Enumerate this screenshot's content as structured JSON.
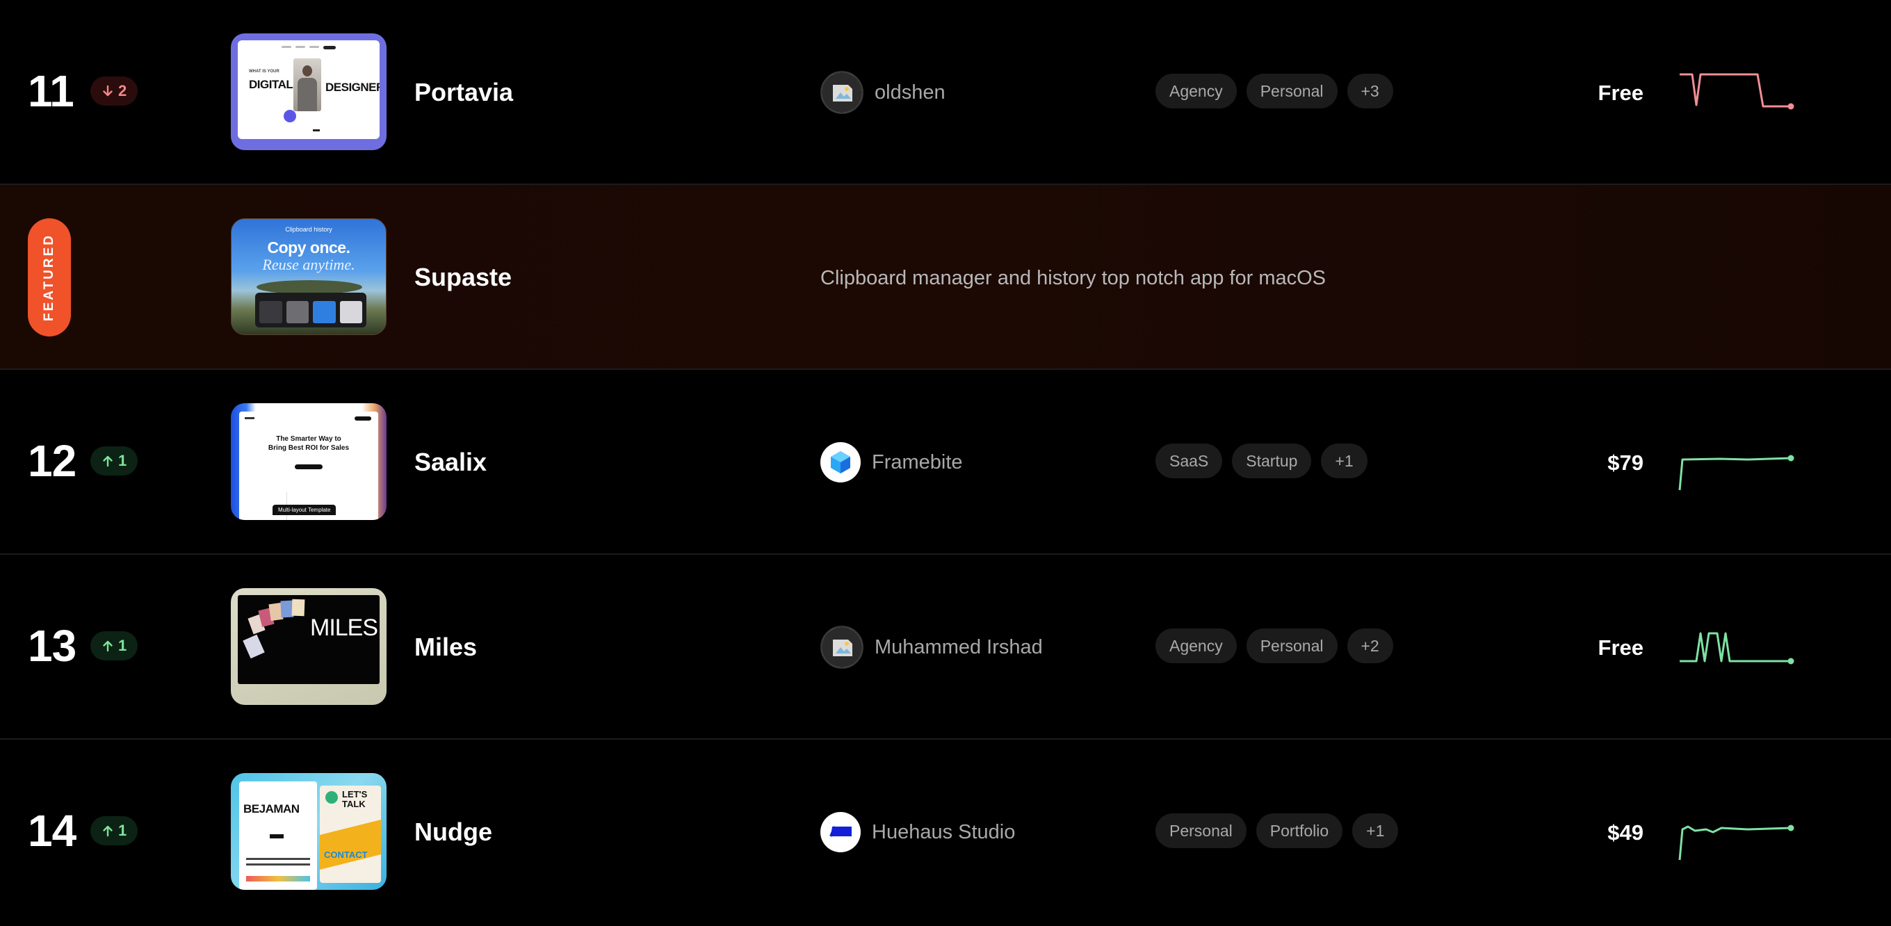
{
  "rows": [
    {
      "rank": "11",
      "delta": {
        "direction": "down",
        "value": "2",
        "icon": "arrow-down-icon"
      },
      "name": "Portavia",
      "author": "oldshen",
      "tags": [
        "Agency",
        "Personal",
        "+3"
      ],
      "price": "Free",
      "thumb_text": {
        "topline": "WHAT IS YOUR",
        "left": "DIGITAL",
        "right": "DESIGNER"
      },
      "trend_color": "#f18f94"
    },
    {
      "featured": true,
      "featured_label": "FEATURED",
      "name": "Supaste",
      "description": "Clipboard manager and history top notch app for macOS",
      "thumb_text": {
        "caption": "Clipboard history",
        "headline": "Copy once.",
        "subline": "Reuse anytime."
      }
    },
    {
      "rank": "12",
      "delta": {
        "direction": "up",
        "value": "1",
        "icon": "arrow-up-icon"
      },
      "name": "Saalix",
      "author": "Framebite",
      "tags": [
        "SaaS",
        "Startup",
        "+1"
      ],
      "price": "$79",
      "thumb_text": {
        "headline": "The Smarter Way to",
        "subline": "Bring Best ROI for Sales",
        "badge": "Multi-layout Template"
      },
      "trend_color": "#7fe1a4"
    },
    {
      "rank": "13",
      "delta": {
        "direction": "up",
        "value": "1",
        "icon": "arrow-up-icon"
      },
      "name": "Miles",
      "author": "Muhammed Irshad",
      "tags": [
        "Agency",
        "Personal",
        "+2"
      ],
      "price": "Free",
      "thumb_text": {
        "headline": "MILES"
      },
      "trend_color": "#7fe1a4"
    },
    {
      "rank": "14",
      "delta": {
        "direction": "up",
        "value": "1",
        "icon": "arrow-up-icon"
      },
      "name": "Nudge",
      "author": "Huehaus Studio",
      "tags": [
        "Personal",
        "Portfolio",
        "+1"
      ],
      "price": "$49",
      "thumb_text": {
        "headline": "BEJAMAN",
        "talk": "LET'S TALK",
        "contact": "CONTACT"
      },
      "trend_color": "#7fe1a4"
    }
  ],
  "colors": {
    "background": "#000000",
    "featured_pill": "#f0522a",
    "up": "#7ee49b",
    "down": "#f3888a"
  }
}
